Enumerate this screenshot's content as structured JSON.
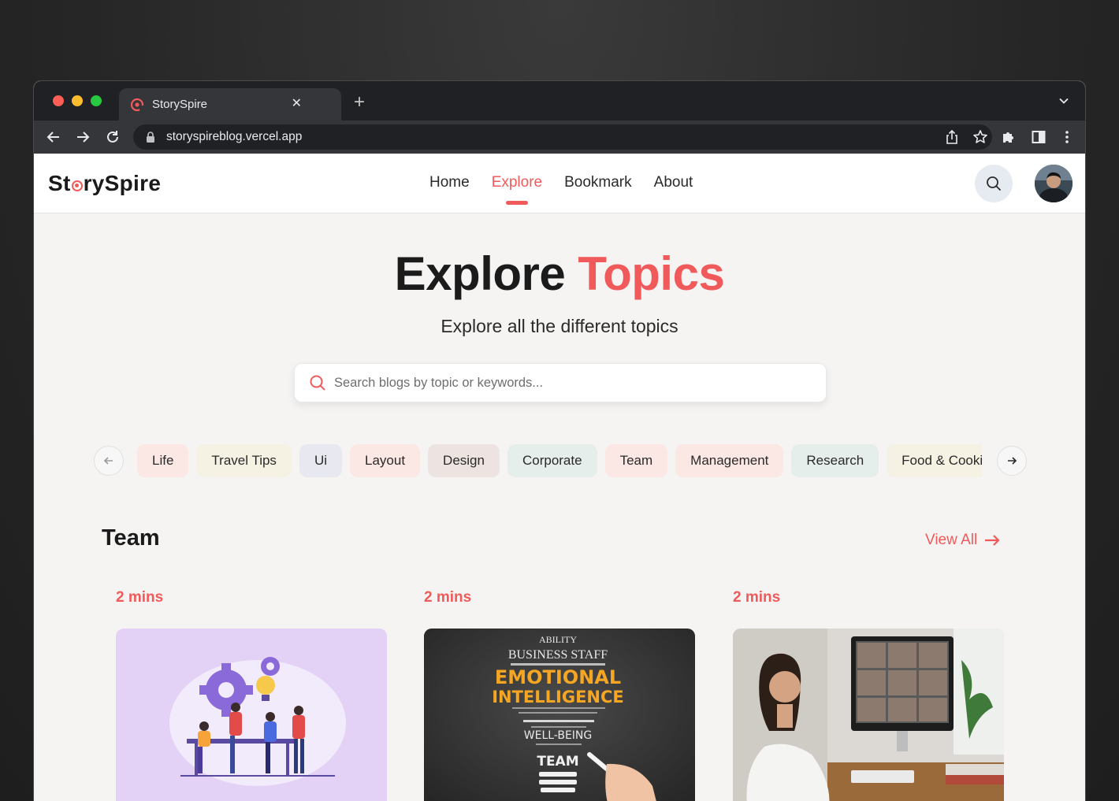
{
  "browser": {
    "tab_title": "StorySpire",
    "url": "storyspireblog.vercel.app"
  },
  "site": {
    "logo_prefix": "St",
    "logo_suffix": "rySpire",
    "nav": [
      {
        "label": "Home"
      },
      {
        "label": "Explore",
        "active": true
      },
      {
        "label": "Bookmark"
      },
      {
        "label": "About"
      }
    ]
  },
  "hero": {
    "title_main": "Explore",
    "title_accent": "Topics",
    "subtitle": "Explore all the different topics",
    "search_placeholder": "Search blogs by topic or keywords..."
  },
  "topics": [
    {
      "label": "Life",
      "bg": "#fbe7e3"
    },
    {
      "label": "Travel Tips",
      "bg": "#f5f1e3"
    },
    {
      "label": "Ui",
      "bg": "#e8e8f1"
    },
    {
      "label": "Layout",
      "bg": "#fbe7e3"
    },
    {
      "label": "Design",
      "bg": "#ede4e1"
    },
    {
      "label": "Corporate",
      "bg": "#e6eeeb"
    },
    {
      "label": "Team",
      "bg": "#fbe7e3"
    },
    {
      "label": "Management",
      "bg": "#fbe7e3"
    },
    {
      "label": "Research",
      "bg": "#e6eeeb"
    },
    {
      "label": "Food & Cooking",
      "bg": "#f5f1e3"
    }
  ],
  "section": {
    "title": "Team",
    "view_all": "View All"
  },
  "cards": [
    {
      "time": "2 mins",
      "image": "team-illustration"
    },
    {
      "time": "2 mins",
      "image": "emotional-intelligence-chalkboard"
    },
    {
      "time": "2 mins",
      "image": "video-call-woman"
    }
  ],
  "colors": {
    "accent": "#f05a5a",
    "page_bg": "#f5f4f3"
  },
  "chalkboard_words": {
    "line1": "ABILITY",
    "line2": "BUSINESS STAFF",
    "line3": "EMOTIONAL",
    "line4": "INTELLIGENCE",
    "line5": "WELL-BEING",
    "line6": "TEAM"
  }
}
